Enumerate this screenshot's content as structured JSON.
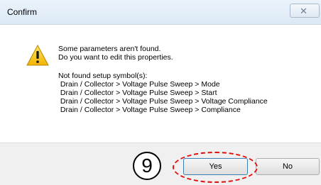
{
  "window": {
    "title": "Confirm",
    "close_glyph": "✕"
  },
  "message": {
    "line1": "Some parameters aren't found.",
    "line2": "Do you want to edit this properties.",
    "not_found_header": "Not found setup symbol(s):",
    "symbols": [
      " Drain / Collector > Voltage Pulse Sweep > Mode",
      " Drain / Collector > Voltage Pulse Sweep > Start",
      " Drain / Collector > Voltage Pulse Sweep > Voltage Compliance",
      " Drain / Collector > Voltage Pulse Sweep > Compliance"
    ]
  },
  "buttons": {
    "yes_label": "Yes",
    "no_label": "No"
  },
  "annotation": {
    "step_number": "9",
    "highlight_color": "#e01010"
  },
  "icons": {
    "warning": "warning-icon",
    "close": "close-icon"
  }
}
